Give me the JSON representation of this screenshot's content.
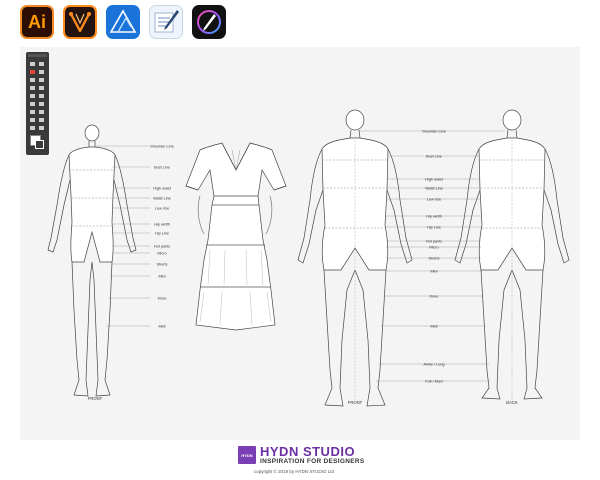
{
  "apps": [
    {
      "name": "illustrator",
      "label": "Ai"
    },
    {
      "name": "vectornator"
    },
    {
      "name": "affinity-designer"
    },
    {
      "name": "paper"
    },
    {
      "name": "procreate"
    }
  ],
  "figure_labels": {
    "shoulder": "Shoulder Line",
    "bust": "Bust Line",
    "high_waist": "High waist",
    "waist": "Waist Line",
    "low_rise": "Low rise",
    "hip_width": "Hip width",
    "hip_line": "Hip Line",
    "hot_pants": "Hot pants",
    "micro": "Micro",
    "shorts": "Shorts",
    "mini": "Mini",
    "knee": "Knee",
    "midi": "Midi",
    "ankle": "Ankle / Long",
    "maxi": "Full / Maxi"
  },
  "views": {
    "front": "FRONT",
    "back": "BACK"
  },
  "footer": {
    "logo_text": "HYDN",
    "brand": "HYDN STUDIO",
    "tagline": "INSPIRATION FOR DESIGNERS",
    "copyright": "copyright © 2019 by HYDN STUDIO Ltd"
  },
  "colors": {
    "brand": "#6a2fa3",
    "illustrator_orange": "#ff9a00",
    "affinity_blue": "#1a73d9"
  }
}
